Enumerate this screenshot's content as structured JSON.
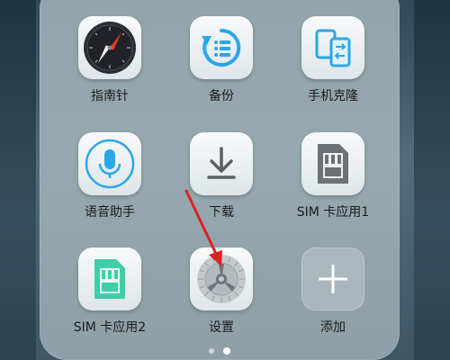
{
  "apps": [
    {
      "label": "指南针",
      "icon": "compass-icon"
    },
    {
      "label": "备份",
      "icon": "backup-icon"
    },
    {
      "label": "手机克隆",
      "icon": "phone-clone-icon"
    },
    {
      "label": "语音助手",
      "icon": "microphone-icon"
    },
    {
      "label": "下载",
      "icon": "download-icon"
    },
    {
      "label": "SIM 卡应用1",
      "icon": "sim-card-icon"
    },
    {
      "label": "SIM 卡应用2",
      "icon": "sim-card-icon"
    },
    {
      "label": "设置",
      "icon": "gear-icon"
    },
    {
      "label": "添加",
      "icon": "plus-icon"
    }
  ],
  "pager": {
    "pages": 2,
    "current_page": 2
  },
  "colors": {
    "accent_blue": "#2aa7e8",
    "sim_green": "#3ecfa8",
    "annotation_red": "#e02020"
  }
}
